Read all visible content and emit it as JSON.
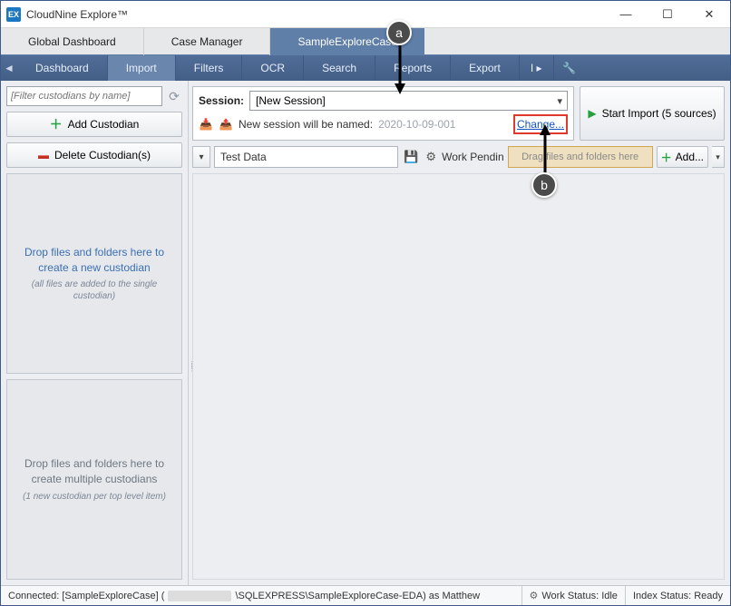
{
  "titlebar": {
    "title": "CloudNine Explore™"
  },
  "topTabs": {
    "items": [
      "Global Dashboard",
      "Case Manager",
      "SampleExploreCase"
    ],
    "activeIndex": 2
  },
  "nav": {
    "items": [
      "Dashboard",
      "Import",
      "Filters",
      "OCR",
      "Search",
      "Reports",
      "Export",
      "I"
    ],
    "activeIndex": 1
  },
  "sidebar": {
    "filterPlaceholder": "[Filter custodians by name]",
    "addLabel": "Add Custodian",
    "deleteLabel": "Delete Custodian(s)",
    "drop1": {
      "main": "Drop files and folders here to create a new custodian",
      "sub": "(all files are added to the single custodian)"
    },
    "drop2": {
      "main": "Drop files and folders here to create multiple custodians",
      "sub": "(1 new custodian per top level item)"
    }
  },
  "session": {
    "label": "Session:",
    "value": "[New Session]",
    "namedText": "New session will be named:",
    "namedDate": "2020-10-09-001",
    "changeLabel": "Change..."
  },
  "startImport": {
    "label": "Start Import (5 sources)"
  },
  "dataRow": {
    "testData": "Test Data",
    "workPending": "Work Pendin",
    "dragHint": "Drag files and folders here",
    "addLabel": "Add..."
  },
  "status": {
    "connected": "Connected: [SampleExploreCase] (",
    "connected2": "\\SQLEXPRESS\\SampleExploreCase-EDA) as Matthew",
    "workStatus": "Work Status: Idle",
    "indexStatus": "Index Status: Ready"
  },
  "callouts": {
    "a": "a",
    "b": "b"
  }
}
